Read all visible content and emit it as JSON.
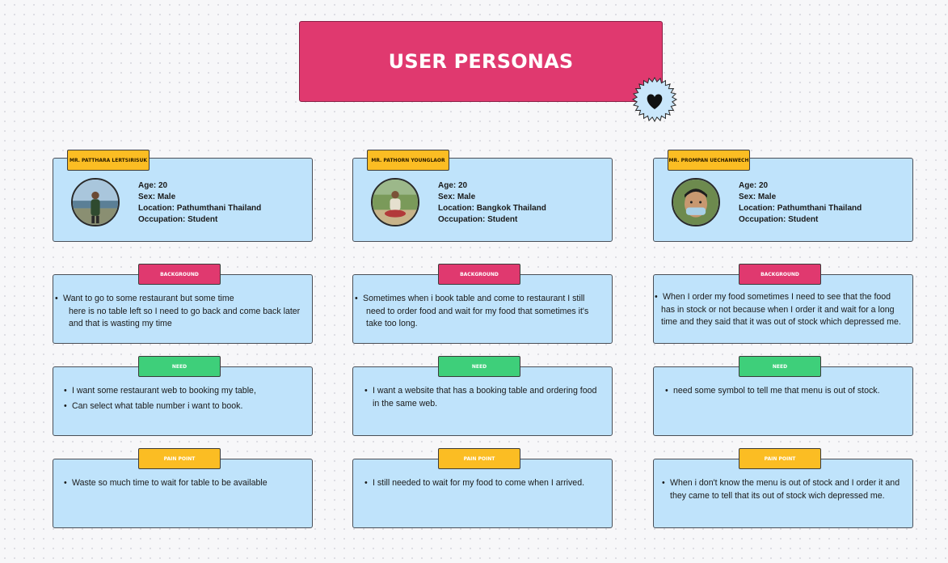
{
  "title": "USER PERSONAS",
  "colors": {
    "title_bg": "#e0396f",
    "name_tag": "#fbbd23",
    "background_tag": "#e0396f",
    "need_tag": "#3ecf7a",
    "pain_tag": "#fbbd23",
    "card_bg": "#bfe3fb"
  },
  "icons": {
    "badge": "heart-icon"
  },
  "personas": [
    {
      "name": "MR. PATTHARA LERTSIRISUK",
      "age": "Age: 20",
      "sex": "Sex: Male",
      "location": "Location: Pathumthani Thailand",
      "occupation": "Occupation: Student",
      "background_label": "BACKGROUND",
      "background": [
        "Want to go to some restaurant but some time",
        "here is no table left so I need to go back and come back later",
        "and that is wasting my time"
      ],
      "need_label": "NEED",
      "needs": [
        "I want some restaurant web to booking my table,",
        "Can select what table number i want to book."
      ],
      "pain_label": "PAIN POINT",
      "pain_points": [
        "Waste so much time to wait for table to be available"
      ]
    },
    {
      "name": "MR. PATHORN YOUNGLAOR",
      "age": "Age: 20",
      "sex": "Sex: Male",
      "location": "Location: Bangkok Thailand",
      "occupation": "Occupation: Student",
      "background_label": "BACKGROUND",
      "background": [
        "Sometimes when i book table and come to restaurant I still",
        "need to order food and wait for my food that sometimes it's",
        "take too long."
      ],
      "need_label": "NEED",
      "needs": [
        "I want a website that has a booking table and ordering food",
        "in the same web."
      ],
      "pain_label": "PAIN POINT",
      "pain_points": [
        "I still needed to wait for my food to come when I arrived."
      ]
    },
    {
      "name": "MR. PROMPAN UECHANWECH",
      "age": "Age: 20",
      "sex": "Sex: Male",
      "location": "Location: Pathumthani Thailand",
      "occupation": "Occupation: Student",
      "background_label": "BACKGROUND",
      "background": [
        "When I order my food sometimes I need to see that the food",
        "has in stock or not because when I order it and wait for a long",
        "time and they said that it was out of stock which depressed me."
      ],
      "need_label": "NEED",
      "needs": [
        "need some symbol to tell me that menu is out of stock."
      ],
      "pain_label": "PAIN POINT",
      "pain_points": [
        "When i don't know the menu is out of stock and I order it and",
        "they came to tell that its out of stock wich depressed me."
      ]
    }
  ]
}
